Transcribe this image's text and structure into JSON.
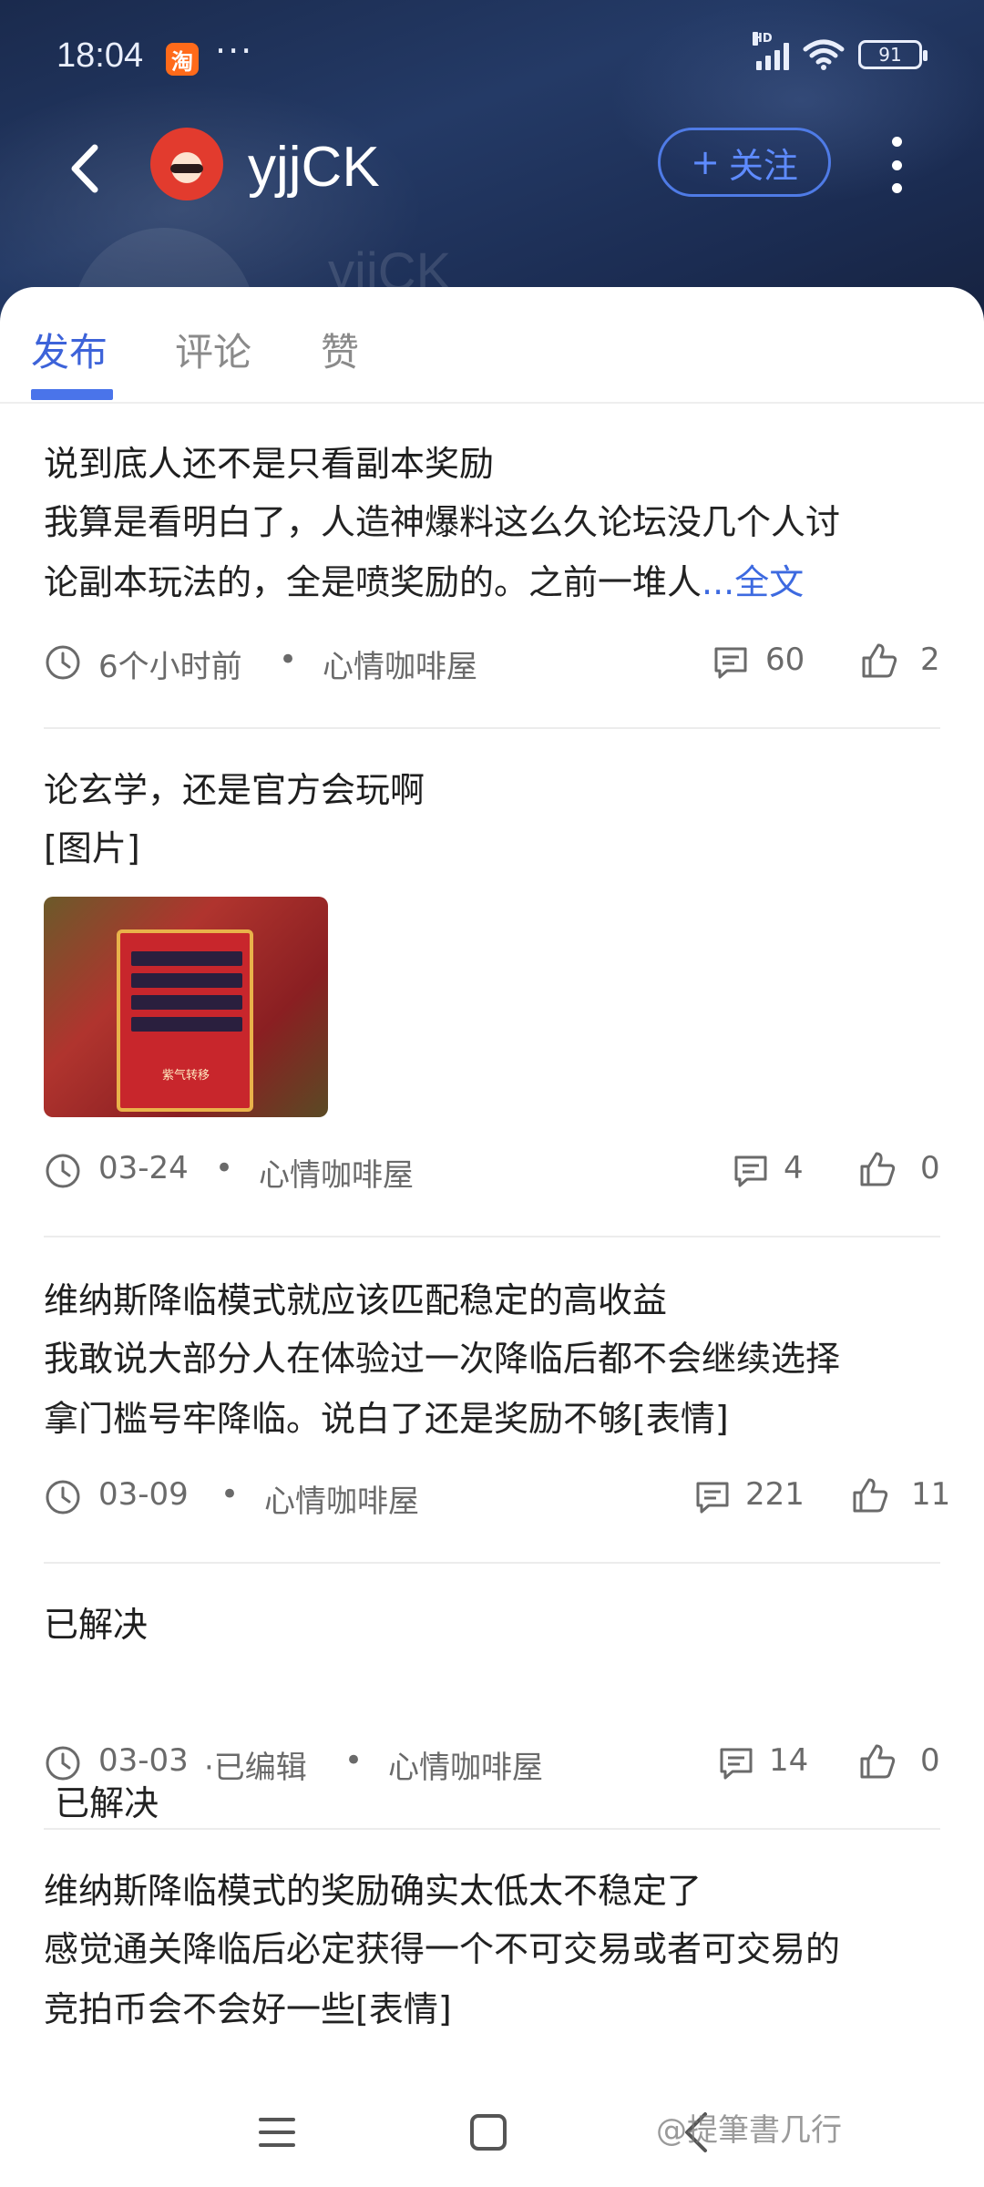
{
  "status_bar": {
    "time": "18:04",
    "app_badge": "淘",
    "dots": "···",
    "network": "HD",
    "battery": "91"
  },
  "header": {
    "username": "yjjCK",
    "follow_label": "关注",
    "follow_plus": "+"
  },
  "tabs": [
    {
      "label": "发布",
      "active": true
    },
    {
      "label": "评论",
      "active": false
    },
    {
      "label": "赞",
      "active": false
    }
  ],
  "posts": [
    {
      "title": "说到底人还不是只看副本奖励",
      "body_line1": "我算是看明白了，人造神爆料这么久论坛没几个人讨",
      "body_line2": "论副本玩法的，全是喷奖励的。之前一堆人",
      "more": "...全文",
      "time": "6个小时前",
      "forum": "心情咖啡屋",
      "comments": "60",
      "likes": "2"
    },
    {
      "title": "论玄学，还是官方会玩啊",
      "body_line1": "[图片]",
      "image_label": "紫气转移",
      "time": "03-24",
      "forum": "心情咖啡屋",
      "comments": "4",
      "likes": "0"
    },
    {
      "title": "维纳斯降临模式就应该匹配稳定的高收益",
      "body_line1": "我敢说大部分人在体验过一次降临后都不会继续选择",
      "body_line2": "拿门槛号牢降临。说白了还是奖励不够[表情]",
      "time": "03-09",
      "forum": "心情咖啡屋",
      "comments": "221",
      "likes": "11"
    },
    {
      "title": "已解决",
      "body_line1": " 已解决",
      "time": "03-03",
      "edited": "·已编辑",
      "forum": "心情咖啡屋",
      "comments": "14",
      "likes": "0"
    },
    {
      "title": "维纳斯降临模式的奖励确实太低太不稳定了",
      "body_line1": "感觉通关降临后必定获得一个不可交易或者可交易的",
      "body_line2": "竞拍币会不会好一些[表情]"
    }
  ],
  "meta_separator": "•",
  "watermark": "@提筆書几行",
  "colors": {
    "accent": "#3d63d9",
    "header_bg": "#1f3360",
    "link": "#3d6ae0"
  }
}
